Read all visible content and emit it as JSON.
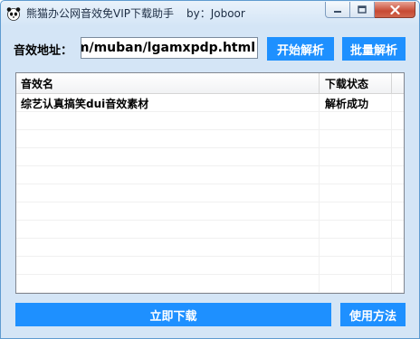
{
  "window": {
    "title": "熊猫办公网音效免VIP下载助手",
    "byline": "by：Joboor"
  },
  "form": {
    "label": "音效地址：",
    "url_value": "https://www.tukuppt.com/muban/lgamxpdp.html",
    "start_button": "开始解析",
    "batch_button": "批量解析"
  },
  "list": {
    "columns": [
      "音效名",
      "下载状态"
    ],
    "rows": [
      {
        "name": "综艺认真搞笑dui音效素材",
        "status": "解析成功"
      }
    ],
    "empty_rows": 10
  },
  "footer": {
    "download_button": "立即下载",
    "help_button": "使用方法"
  },
  "colors": {
    "accent": "#1e90ff",
    "window_bg": "#d4e5f6"
  },
  "icons": [
    "panda-icon",
    "minimize-icon",
    "maximize-icon",
    "close-icon"
  ]
}
